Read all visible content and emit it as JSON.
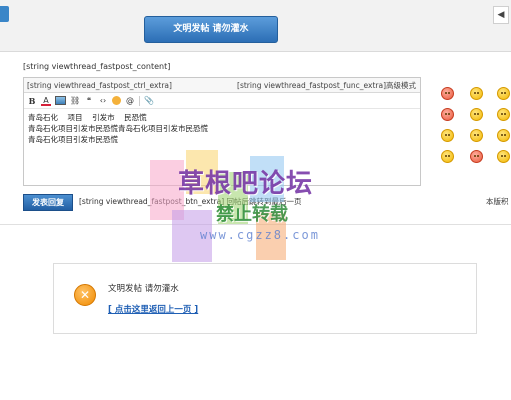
{
  "top_notice": "文明发帖 请勿灌水",
  "right_arrow": "◀",
  "content_label": "[string viewthread_fastpost_content]",
  "editor": {
    "ctrl_extra": "[string viewthread_fastpost_ctrl_extra]",
    "func_extra": "[string viewthread_fastpost_func_extra]高级模式",
    "toolbar": [
      "B",
      "A",
      "img",
      "link",
      "quote",
      "code",
      "emoji",
      "@",
      "attach"
    ],
    "lines": [
      "青岛石化    项目    引发市    民恐慌",
      "青岛石化项目引发市民恐慌青岛石化项目引发市民恐慌",
      "青岛石化项目引发市民恐慌"
    ]
  },
  "smilies": [
    "smile",
    "grin",
    "laugh",
    "angry",
    "shock",
    "cool",
    "tongue",
    "wink",
    "happy",
    "sad",
    "cry",
    "shy"
  ],
  "reply_button": "发表回复",
  "btn_extra": "[string viewthread_fastpost_btn_extra]    回帖后跳转到最后一页",
  "copyright_tail": "本版积",
  "watermark": {
    "title": "草根吧论坛",
    "subtitle": "禁止转载",
    "url": "www.cgzz8.com",
    "colors": [
      "#f7a6c9",
      "#f9d36b",
      "#9ad16b",
      "#8ec5f0",
      "#c39be8",
      "#f5a86e"
    ]
  },
  "message": {
    "text": "文明发帖 请勿灌水",
    "link": "[ 点击这里返回上一页 ]",
    "icon": "close-icon"
  }
}
